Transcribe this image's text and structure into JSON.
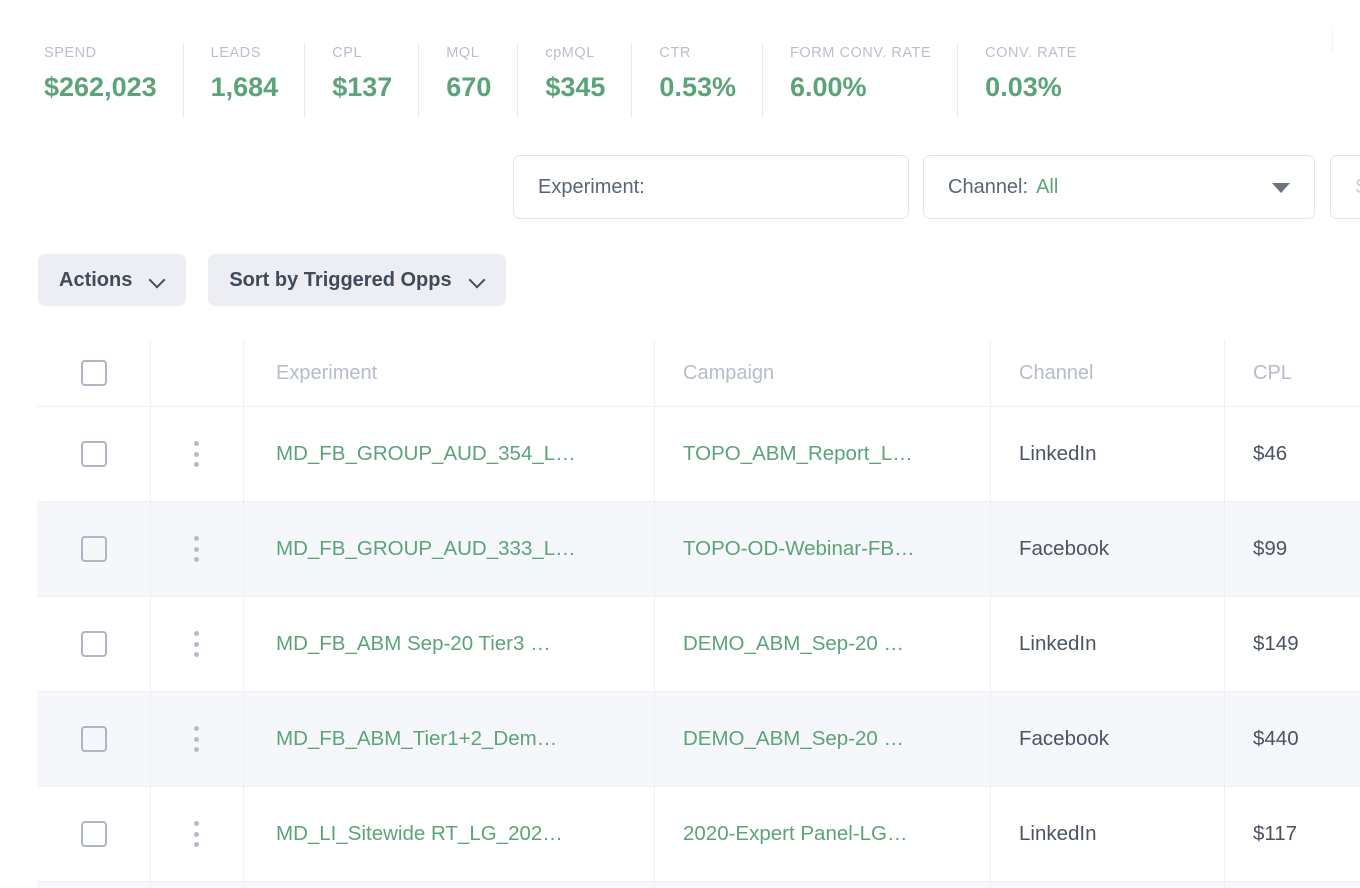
{
  "kpis": [
    {
      "label": "SPEND",
      "value": "$262,023"
    },
    {
      "label": "LEADS",
      "value": "1,684"
    },
    {
      "label": "CPL",
      "value": "$137"
    },
    {
      "label": "MQL",
      "value": "670"
    },
    {
      "label": "cpMQL",
      "value": "$345"
    },
    {
      "label": "CTR",
      "value": "0.53%"
    },
    {
      "label": "FORM CONV. RATE",
      "value": "6.00%"
    },
    {
      "label": "CONV. RATE",
      "value": "0.03%"
    }
  ],
  "filters": {
    "experiment": {
      "label": "Experiment:",
      "value": ""
    },
    "channel": {
      "label": "Channel:",
      "value": "All"
    },
    "third": {
      "label": "S"
    }
  },
  "toolbar": {
    "actions_label": "Actions",
    "sort_label": "Sort by Triggered Opps"
  },
  "table": {
    "columns": {
      "experiment": "Experiment",
      "campaign": "Campaign",
      "channel": "Channel",
      "cpl": "CPL"
    },
    "rows": [
      {
        "experiment": "MD_FB_GROUP_AUD_354_L…",
        "campaign": "TOPO_ABM_Report_L…",
        "channel": "LinkedIn",
        "cpl": "$46"
      },
      {
        "experiment": "MD_FB_GROUP_AUD_333_L…",
        "campaign": "TOPO-OD-Webinar-FB…",
        "channel": "Facebook",
        "cpl": "$99"
      },
      {
        "experiment": "MD_FB_ABM Sep-20 Tier3 …",
        "campaign": "DEMO_ABM_Sep-20 …",
        "channel": "LinkedIn",
        "cpl": "$149"
      },
      {
        "experiment": "MD_FB_ABM_Tier1+2_Dem…",
        "campaign": "DEMO_ABM_Sep-20 …",
        "channel": "Facebook",
        "cpl": "$440"
      },
      {
        "experiment": "MD_LI_Sitewide RT_LG_202…",
        "campaign": "2020-Expert Panel-LG…",
        "channel": "LinkedIn",
        "cpl": "$117"
      }
    ]
  },
  "colors": {
    "accent_green": "#5ba477",
    "label_gray": "#b9bfcc",
    "text_dark": "#3f4b5b",
    "stripe": "#f6f7fa",
    "border": "#eef0f4",
    "toolbar_btn": "#eceef4"
  }
}
